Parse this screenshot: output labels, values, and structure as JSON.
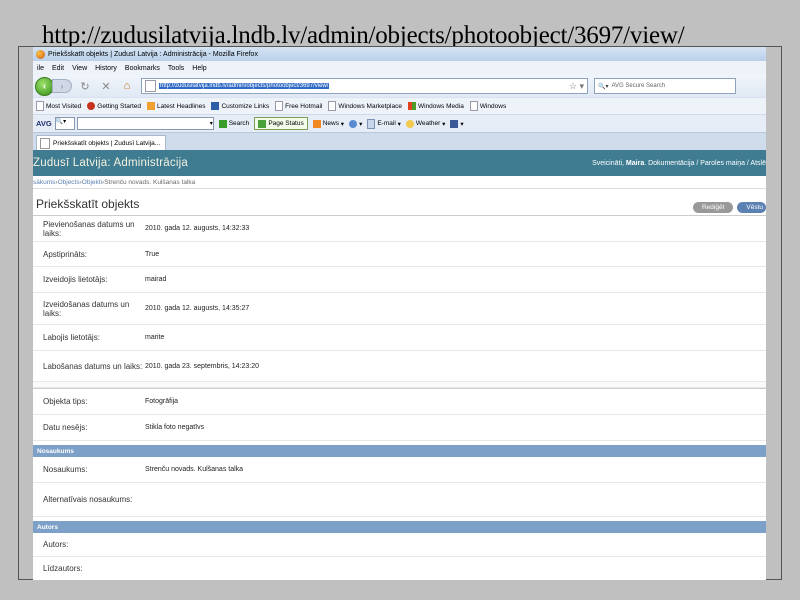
{
  "slide": {
    "url_caption": "http://zudusilatvija.lndb.lv/admin/objects/photoobject/3697/view/"
  },
  "browser": {
    "window_title": "Priekšskatīt objekts | Zudusī Latvija : Administrācija - Mozilla Firefox",
    "menu": [
      "File",
      "Edit",
      "View",
      "History",
      "Bookmarks",
      "Tools",
      "Help"
    ],
    "menu_visible": [
      "ile",
      "Edit",
      "View",
      "History",
      "Bookmarks",
      "Tools",
      "Help"
    ],
    "address": "http://zudusilatvija.lndb.lv/admin/objects/photoobject/3697/view/",
    "search_placeholder": "AVG Secure Search",
    "bookmarks": [
      "Most Visited",
      "Getting Started",
      "Latest Headlines",
      "Customize Links",
      "Free Hotmail",
      "Windows Marketplace",
      "Windows Media",
      "Windows"
    ],
    "avg_toolbar": {
      "logo": "AVG",
      "search_btn": "Search",
      "page_status": "Page Status",
      "news": "News",
      "email": "E-mail",
      "weather": "Weather"
    },
    "tab_title": "Priekšskatīt objekts | Zudusī Latvija..."
  },
  "site": {
    "title": "Zudusī Latvija: Administrācija",
    "user_tools": {
      "greeting": "Sveicināti,",
      "user": "Maira",
      "links": ". Dokumentācija / Paroles maiņa / Atslē"
    },
    "breadcrumbs": [
      "sākums",
      "Objects",
      "Objekti",
      "Strenču novads. Kulšanas talka"
    ],
    "breadcrumb_sep": " › "
  },
  "page": {
    "title": "Priekšskatīt objekts",
    "tools": {
      "edit": "Rediģēt",
      "history": "Vēstu"
    },
    "fields_main": [
      {
        "label": "Pievienošanas datums un laiks:",
        "value": "2010. gada 12. augusts, 14:32:33"
      },
      {
        "label": "Apstiprināts:",
        "value": "True"
      },
      {
        "label": "Izveidojis lietotājs:",
        "value": "mairad"
      },
      {
        "label": "Izveidošanas datums un laiks:",
        "value": "2010. gada 12. augusts, 14:35:27"
      },
      {
        "label": "Labojis lietotājs:",
        "value": "marite"
      },
      {
        "label": "Labošanas datums un laiks:",
        "value": "2010. gada 23. septembris, 14:23:20"
      }
    ],
    "fields_type": [
      {
        "label": "Objekta tips:",
        "value": "Fotogrāfija"
      },
      {
        "label": "Datu nesējs:",
        "value": "Stikla foto negatīvs"
      }
    ],
    "section_name": {
      "heading": "Nosaukums",
      "fields": [
        {
          "label": "Nosaukums:",
          "value": "Strenču novads. Kulšanas talka"
        },
        {
          "label": "Alternatīvais nosaukums:",
          "value": ""
        }
      ]
    },
    "section_author": {
      "heading": "Autors",
      "fields": [
        {
          "label": "Autors:",
          "value": ""
        },
        {
          "label": "Līdzautors:",
          "value": ""
        }
      ]
    }
  }
}
